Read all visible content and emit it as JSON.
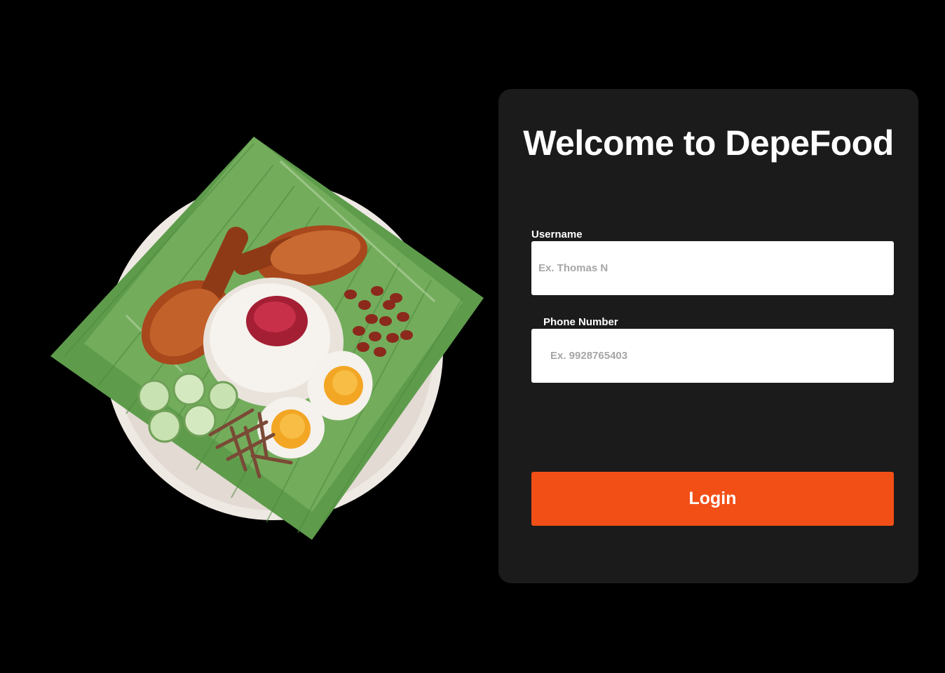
{
  "app": {
    "title": "Welcome to DepeFood",
    "accent_color": "#f24f17",
    "card_color": "#1b1b1b",
    "background_color": "#000000"
  },
  "illustration": {
    "icon": "nasi-lemak-illustration"
  },
  "form": {
    "username": {
      "label": "Username",
      "placeholder": "Ex. Thomas N",
      "value": ""
    },
    "phone": {
      "label": "Phone Number",
      "placeholder": "Ex. 9928765403",
      "value": ""
    },
    "login_label": "Login"
  }
}
